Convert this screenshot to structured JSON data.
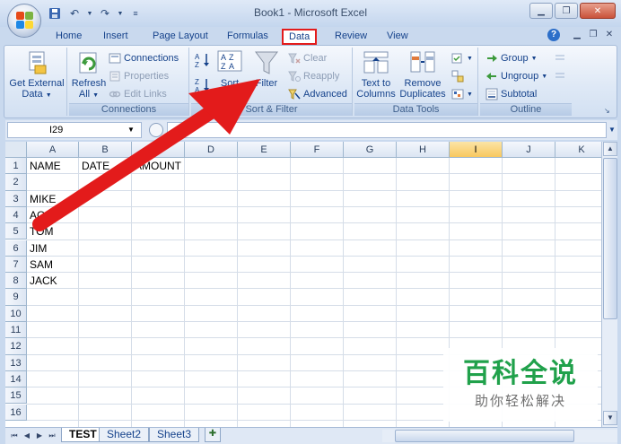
{
  "window": {
    "title": "Book1 - Microsoft Excel",
    "controls": [
      "minimize",
      "restore",
      "close"
    ]
  },
  "ribbon_tabs": [
    {
      "label": "Home"
    },
    {
      "label": "Insert"
    },
    {
      "label": "Page Layout"
    },
    {
      "label": "Formulas"
    },
    {
      "label": "Data",
      "active": true
    },
    {
      "label": "Review"
    },
    {
      "label": "View"
    }
  ],
  "groups": {
    "get_external": {
      "label_line1": "Get External",
      "label_line2": "Data"
    },
    "connections": {
      "label": "Connections",
      "refresh_line1": "Refresh",
      "refresh_line2": "All",
      "connections": "Connections",
      "properties": "Properties",
      "edit_links": "Edit Links"
    },
    "sort_filter": {
      "label": "Sort & Filter",
      "sort": "Sort",
      "filter": "Filter",
      "clear": "Clear",
      "reapply": "Reapply",
      "advanced": "Advanced"
    },
    "data_tools": {
      "label": "Data Tools",
      "text_to_columns_line1": "Text to",
      "text_to_columns_line2": "Columns",
      "remove_dup_line1": "Remove",
      "remove_dup_line2": "Duplicates"
    },
    "outline": {
      "label": "Outline",
      "group": "Group",
      "ungroup": "Ungroup",
      "subtotal": "Subtotal"
    }
  },
  "formula_bar": {
    "name_box": "I29",
    "formula": ""
  },
  "grid": {
    "columns": [
      "A",
      "B",
      "C",
      "D",
      "E",
      "F",
      "G",
      "H",
      "I",
      "J",
      "K"
    ],
    "selected_column": "I",
    "rows": [
      "1",
      "2",
      "3",
      "4",
      "5",
      "6",
      "7",
      "8",
      "9",
      "10",
      "11",
      "12",
      "13",
      "14",
      "15",
      "16"
    ],
    "cells": {
      "A1": "NAME",
      "B1": "DATE",
      "C1": "AMOUNT",
      "A3": "MIKE",
      "A4": "AGN",
      "A5": "TOM",
      "A6": "JIM",
      "A7": "SAM",
      "A8": "JACK"
    }
  },
  "sheet_tabs": [
    {
      "label": "TEST",
      "active": true
    },
    {
      "label": "Sheet2"
    },
    {
      "label": "Sheet3"
    }
  ],
  "watermark": {
    "title": "百科全说",
    "subtitle": "助你轻松解决"
  },
  "colors": {
    "annotation_red": "#e31b1b",
    "selected_column": "#f8c85f",
    "watermark_green": "#20a14b"
  }
}
